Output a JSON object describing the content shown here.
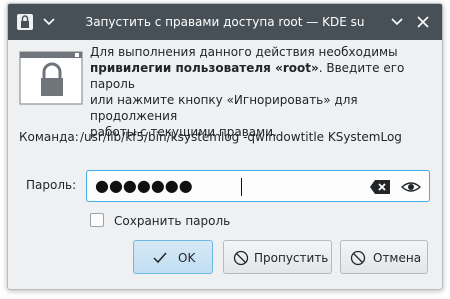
{
  "titlebar": {
    "title": "Запустить с правами доступа root — KDE su",
    "app_icon": "lock-app-icon",
    "minimize_icon": "chevron-down-icon",
    "close_icon": "close-icon"
  },
  "message": {
    "line1": "Для выполнения данного действия необходимы",
    "line2_bold": "привилегии пользователя «root»",
    "line2_rest": ". Введите его пароль",
    "line3": "или нажмите кнопку «Игнорировать» для продолжения",
    "line4": "работы с текущими правами."
  },
  "command": {
    "label": "Команда:",
    "value": "/usr/lib/kf5/bin/ksystemlog -qwindowtitle KSystemLog"
  },
  "password": {
    "label": "Пароль:",
    "masked_value": "●●●●●●●",
    "clear_icon": "backspace-clear-icon",
    "reveal_icon": "eye-icon"
  },
  "remember": {
    "label": "Сохранить пароль",
    "checked": false
  },
  "buttons": {
    "ok": "OK",
    "skip": "Пропустить",
    "cancel": "Отмена"
  },
  "colors": {
    "titlebar": "#475057",
    "window_bg": "#eff0f1",
    "focus_accent": "#3daee9"
  }
}
